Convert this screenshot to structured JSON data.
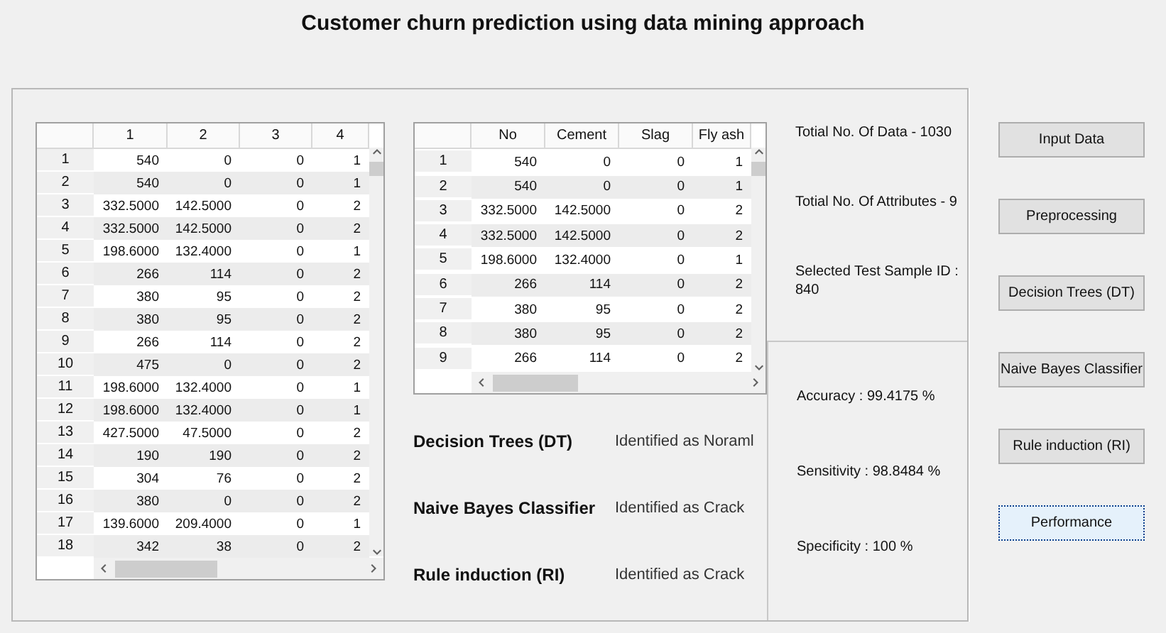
{
  "title": "Customer churn prediction using data mining approach",
  "data_table": {
    "columns": [
      "1",
      "2",
      "3",
      "4"
    ],
    "rows": [
      {
        "header": "1",
        "cells": [
          "540",
          "0",
          "0",
          "1"
        ]
      },
      {
        "header": "2",
        "cells": [
          "540",
          "0",
          "0",
          "1"
        ]
      },
      {
        "header": "3",
        "cells": [
          "332.5000",
          "142.5000",
          "0",
          "2"
        ]
      },
      {
        "header": "4",
        "cells": [
          "332.5000",
          "142.5000",
          "0",
          "2"
        ]
      },
      {
        "header": "5",
        "cells": [
          "198.6000",
          "132.4000",
          "0",
          "1"
        ]
      },
      {
        "header": "6",
        "cells": [
          "266",
          "114",
          "0",
          "2"
        ]
      },
      {
        "header": "7",
        "cells": [
          "380",
          "95",
          "0",
          "2"
        ]
      },
      {
        "header": "8",
        "cells": [
          "380",
          "95",
          "0",
          "2"
        ]
      },
      {
        "header": "9",
        "cells": [
          "266",
          "114",
          "0",
          "2"
        ]
      },
      {
        "header": "10",
        "cells": [
          "475",
          "0",
          "0",
          "2"
        ]
      },
      {
        "header": "11",
        "cells": [
          "198.6000",
          "132.4000",
          "0",
          "1"
        ]
      },
      {
        "header": "12",
        "cells": [
          "198.6000",
          "132.4000",
          "0",
          "1"
        ]
      },
      {
        "header": "13",
        "cells": [
          "427.5000",
          "47.5000",
          "0",
          "2"
        ]
      },
      {
        "header": "14",
        "cells": [
          "190",
          "190",
          "0",
          "2"
        ]
      },
      {
        "header": "15",
        "cells": [
          "304",
          "76",
          "0",
          "2"
        ]
      },
      {
        "header": "16",
        "cells": [
          "380",
          "0",
          "0",
          "2"
        ]
      },
      {
        "header": "17",
        "cells": [
          "139.6000",
          "209.4000",
          "0",
          "1"
        ]
      },
      {
        "header": "18",
        "cells": [
          "342",
          "38",
          "0",
          "2"
        ]
      }
    ]
  },
  "attribute_table": {
    "columns": [
      "No",
      "Cement",
      "Slag",
      "Fly ash"
    ],
    "rows": [
      {
        "header": "1",
        "cells": [
          "540",
          "0",
          "0",
          "1"
        ]
      },
      {
        "header": "2",
        "cells": [
          "540",
          "0",
          "0",
          "1"
        ]
      },
      {
        "header": "3",
        "cells": [
          "332.5000",
          "142.5000",
          "0",
          "2"
        ]
      },
      {
        "header": "4",
        "cells": [
          "332.5000",
          "142.5000",
          "0",
          "2"
        ]
      },
      {
        "header": "5",
        "cells": [
          "198.6000",
          "132.4000",
          "0",
          "1"
        ]
      },
      {
        "header": "6",
        "cells": [
          "266",
          "114",
          "0",
          "2"
        ]
      },
      {
        "header": "7",
        "cells": [
          "380",
          "95",
          "0",
          "2"
        ]
      },
      {
        "header": "8",
        "cells": [
          "380",
          "95",
          "0",
          "2"
        ]
      },
      {
        "header": "9",
        "cells": [
          "266",
          "114",
          "0",
          "2"
        ]
      }
    ]
  },
  "results": [
    {
      "method": "Decision Trees (DT)",
      "outcome": "Identified as Noraml"
    },
    {
      "method": "Naive Bayes Classifier",
      "outcome": "Identified as Crack"
    },
    {
      "method": "Rule induction (RI)",
      "outcome": "Identified as Crack"
    }
  ],
  "info": [
    "Totial No. Of Data - 1030",
    "Totial No. Of Attributes - 9",
    "Selected Test Sample ID : 840"
  ],
  "metrics": [
    "Accuracy : 99.4175 %",
    "Sensitivity : 98.8484 %",
    "Specificity : 100 %"
  ],
  "buttons": [
    {
      "label": "Input Data",
      "selected": false
    },
    {
      "label": "Preprocessing",
      "selected": false
    },
    {
      "label": "Decision Trees (DT)",
      "selected": false
    },
    {
      "label": "Naive Bayes Classifier",
      "selected": false
    },
    {
      "label": "Rule induction (RI)",
      "selected": false
    },
    {
      "label": "Performance",
      "selected": true
    }
  ]
}
